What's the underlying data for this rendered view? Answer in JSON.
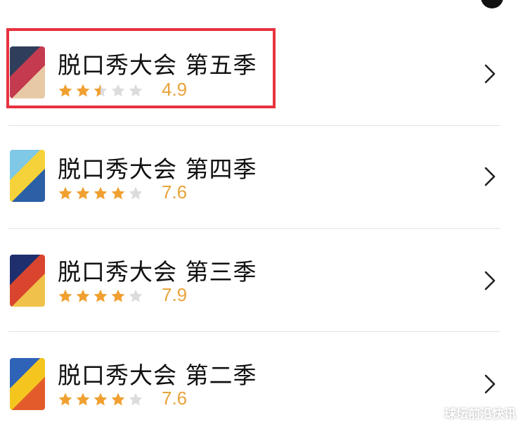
{
  "items": [
    {
      "title": "脱口秀大会 第五季",
      "rating": "4.9",
      "stars": 2.5,
      "poster": [
        "#2f3e5a",
        "#c43a4f",
        "#e8c9a6"
      ]
    },
    {
      "title": "脱口秀大会 第四季",
      "rating": "7.6",
      "stars": 4,
      "poster": [
        "#7fc8e6",
        "#f5d23a",
        "#2b5fa6"
      ]
    },
    {
      "title": "脱口秀大会 第三季",
      "rating": "7.9",
      "stars": 4,
      "poster": [
        "#1f2f6e",
        "#d9452f",
        "#f0c24a"
      ]
    },
    {
      "title": "脱口秀大会 第二季",
      "rating": "7.6",
      "stars": 4,
      "poster": [
        "#2e63b8",
        "#f3c51e",
        "#e35b2a"
      ]
    }
  ],
  "colors": {
    "star_on": "#f0a030",
    "star_off": "#dcdcdc",
    "highlight": "#e8323f"
  },
  "watermark": "球坛前沿快讯"
}
